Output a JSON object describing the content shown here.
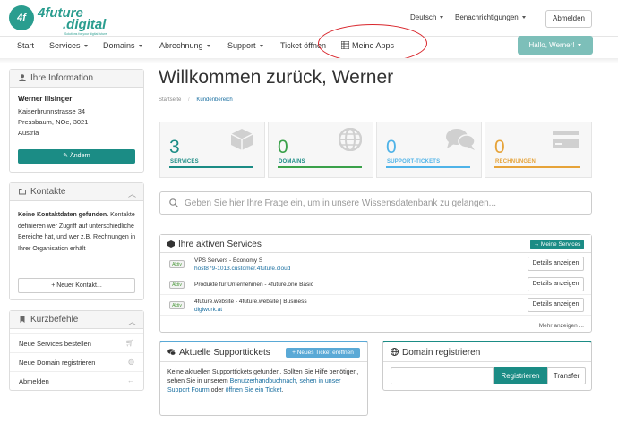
{
  "brand": {
    "logo_mark": "4f",
    "name_line1": "4future",
    "name_line2": ".digital",
    "tagline": "Solutions for your digital future"
  },
  "topbar": {
    "language": "Deutsch",
    "notifications": "Benachrichtigungen",
    "logout": "Abmelden"
  },
  "nav": {
    "items": [
      "Start",
      "Services",
      "Domains",
      "Abrechnung",
      "Support",
      "Ticket öffnen",
      "Meine Apps"
    ],
    "greeting": "Hallo, Werner!"
  },
  "sidebar": {
    "info": {
      "title": "Ihre Information",
      "name": "Werner Illsinger",
      "street": "Kaiserbrunnstrasse 34",
      "city": "Pressbaum, NOe, 3021",
      "country": "Austria",
      "edit_button": "Ändern"
    },
    "contacts": {
      "title": "Kontakte",
      "none_bold": "Keine Kontaktdaten gefunden.",
      "description": "Kontakte definieren wer Zugriff auf unterschiedliche Bereiche hat, und wer z.B. Rechnungen in Ihrer Organisation erhält",
      "new_button": "+ Neuer Kontakt..."
    },
    "shortcuts": {
      "title": "Kurzbefehle",
      "items": [
        "Neue Services bestellen",
        "Neue Domain registrieren",
        "Abmelden"
      ]
    }
  },
  "main": {
    "title": "Willkommen zurück, Werner",
    "breadcrumb": [
      "Startseite",
      "Kundenbereich"
    ],
    "tiles": [
      {
        "value": "3",
        "label": "SERVICES",
        "color": "#1b8c85"
      },
      {
        "value": "0",
        "label": "DOMAINS",
        "color": "#3aa14a"
      },
      {
        "value": "0",
        "label": "SUPPORT-TICKETS",
        "color": "#4fb3e8"
      },
      {
        "value": "0",
        "label": "RECHNUNGEN",
        "color": "#e6a339"
      }
    ],
    "search_placeholder": "Geben Sie hier Ihre Frage ein, um in unsere Wissensdatenbank zu gelangen...",
    "services": {
      "title": "Ihre aktiven Services",
      "my_services_button": "→ Meine Services",
      "rows": [
        {
          "status": "Aktiv",
          "name": "VPS Servers - Economy S",
          "host": "host879-1013.customer.4future.cloud",
          "button": "Details anzeigen"
        },
        {
          "status": "Aktiv",
          "name": "Produkte für Unternehmen - 4future.one Basic",
          "host": "",
          "button": "Details anzeigen"
        },
        {
          "status": "Aktiv",
          "name": "4future.website - 4future.website | Business",
          "host": "digiwork.at",
          "button": "Details anzeigen"
        }
      ],
      "more": "Mehr anzeigen ..."
    },
    "tickets": {
      "title": "Aktuelle Supporttickets",
      "new_button": "+ Neues Ticket eröffnen",
      "text_1": "Keine aktuellen Supporttickets gefunden. Sollten Sie Hilfe benötigen, sehen Sie in unserem ",
      "link_1": "Benutzerhandbuchnach, sehen in unser Support Fourm",
      "text_2": " oder ",
      "link_2": "öffnen Sie ein Ticket",
      "text_3": "."
    },
    "domain": {
      "title": "Domain registrieren",
      "register_button": "Registrieren",
      "transfer_button": "Transfer"
    }
  },
  "colors": {
    "accent": "#1b8c85",
    "annotation": "#d9262c"
  }
}
